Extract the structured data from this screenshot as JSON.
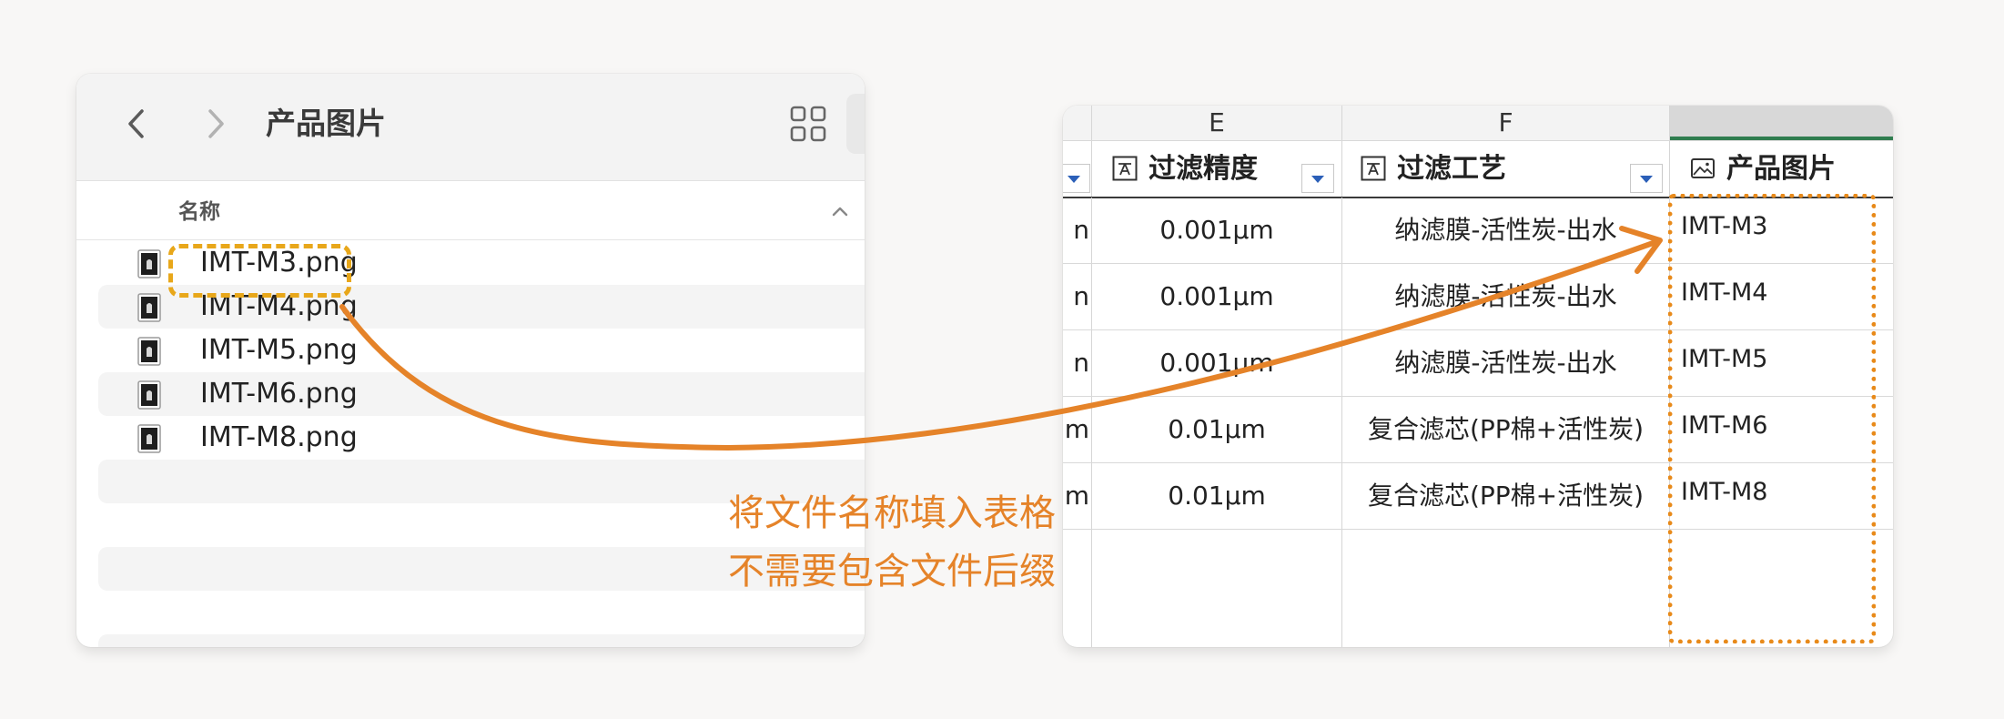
{
  "finder": {
    "title": "产品图片",
    "column_header": "名称",
    "files": [
      {
        "name": "IMT-M3.png"
      },
      {
        "name": "IMT-M4.png"
      },
      {
        "name": "IMT-M5.png"
      },
      {
        "name": "IMT-M6.png"
      },
      {
        "name": "IMT-M8.png"
      }
    ],
    "icons": {
      "back": "chevron-left-icon",
      "forward": "chevron-right-icon",
      "view": "grid-view-icon",
      "sort": "chevron-up-icon",
      "file": "png-file-icon"
    }
  },
  "sheet": {
    "column_letters": [
      "E",
      "F",
      ""
    ],
    "headers": [
      {
        "label": "过滤精度",
        "icon": "text-field-icon"
      },
      {
        "label": "过滤工艺",
        "icon": "text-field-icon"
      },
      {
        "label": "产品图片",
        "icon": "image-field-icon"
      }
    ],
    "rows": [
      {
        "d": "n",
        "e": "0.001μm",
        "f": "纳滤膜-活性炭-出水",
        "g": "IMT-M3"
      },
      {
        "d": "n",
        "e": "0.001μm",
        "f": "纳滤膜-活性炭-出水",
        "g": "IMT-M4"
      },
      {
        "d": "n",
        "e": "0.001μm",
        "f": "纳滤膜-活性炭-出水",
        "g": "IMT-M5"
      },
      {
        "d": "m",
        "e": "0.01μm",
        "f": "复合滤芯(PP棉+活性炭)",
        "g": "IMT-M6"
      },
      {
        "d": "m",
        "e": "0.01μm",
        "f": "复合滤芯(PP棉+活性炭)",
        "g": "IMT-M8"
      }
    ]
  },
  "callout": {
    "line1": "将文件名称填入表格",
    "line2": "不需要包含文件后缀"
  },
  "colors": {
    "accent_orange": "#e58329",
    "highlight_yellow": "#e8a71a",
    "selected_column": "#2f7d4f"
  }
}
